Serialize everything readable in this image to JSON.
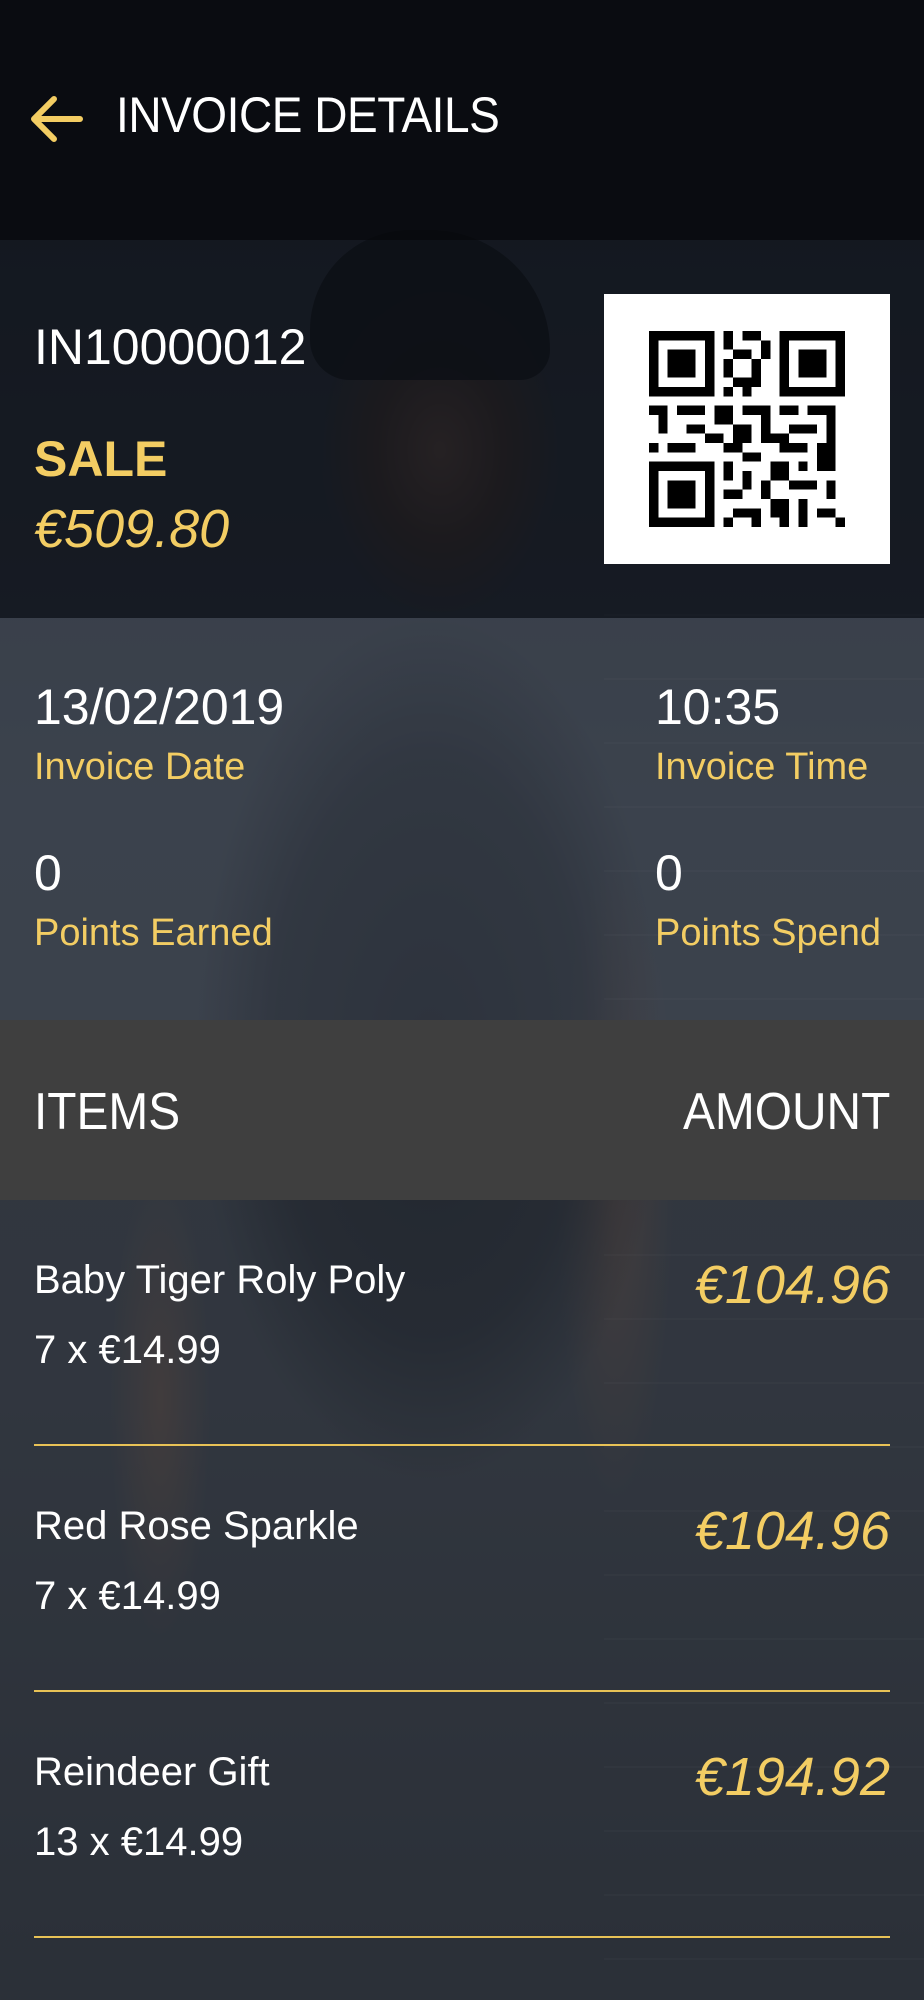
{
  "header": {
    "title": "INVOICE DETAILS"
  },
  "invoice": {
    "number": "IN10000012",
    "type": "SALE",
    "total": "€509.80"
  },
  "info": {
    "date_value": "13/02/2019",
    "date_label": "Invoice Date",
    "time_value": "10:35",
    "time_label": "Invoice Time",
    "points_earned_value": "0",
    "points_earned_label": "Points Earned",
    "points_spend_value": "0",
    "points_spend_label": "Points Spend"
  },
  "items_header": {
    "items": "ITEMS",
    "amount": "AMOUNT"
  },
  "items": [
    {
      "name": "Baby Tiger Roly Poly",
      "qty": "7 x €14.99",
      "amount": "€104.96"
    },
    {
      "name": "Red Rose Sparkle",
      "qty": "7 x €14.99",
      "amount": "€104.96"
    },
    {
      "name": "Reindeer Gift",
      "qty": "13 x €14.99",
      "amount": "€194.92"
    }
  ],
  "colors": {
    "accent": "#f3cd63",
    "header_bg": "#080a0e",
    "items_header_bg": "#3f3f3f"
  },
  "icons": {
    "back": "arrow-left-icon",
    "qr": "qr-code-icon"
  }
}
